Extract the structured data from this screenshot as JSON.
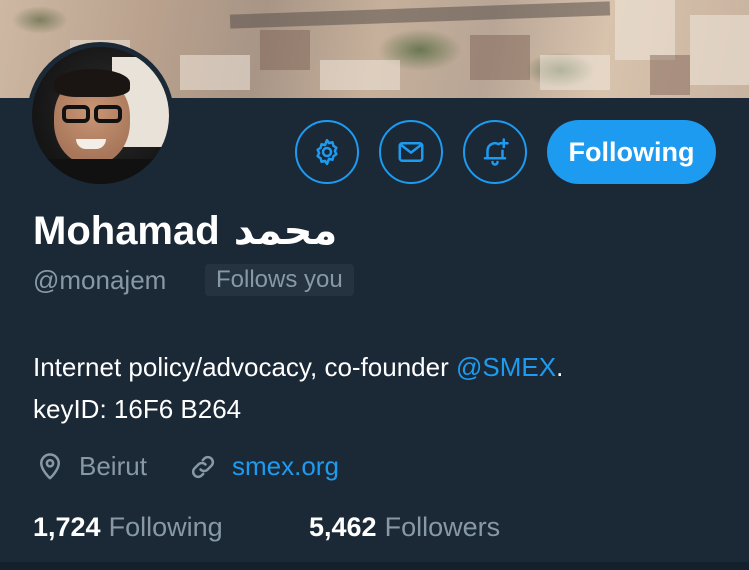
{
  "profile": {
    "name": "Mohamad",
    "name_arabic": "محمد",
    "handle": "@monajem",
    "follows_you_badge": "Follows you",
    "bio_prefix": "Internet policy/advocacy, co-founder ",
    "bio_mention": "@SMEX",
    "bio_suffix": ".",
    "bio_line2": "keyID: 16F6 B264",
    "location": "Beirut",
    "website": "smex.org"
  },
  "actions": {
    "settings_icon": "gear-icon",
    "message_icon": "envelope-icon",
    "notifications_icon": "bell-plus-icon",
    "following_label": "Following"
  },
  "stats": {
    "following_count": "1,724",
    "following_label": "Following",
    "followers_count": "5,462",
    "followers_label": "Followers"
  },
  "colors": {
    "accent": "#1d9bf0",
    "background": "#1b2836",
    "muted_text": "#8899a6"
  }
}
